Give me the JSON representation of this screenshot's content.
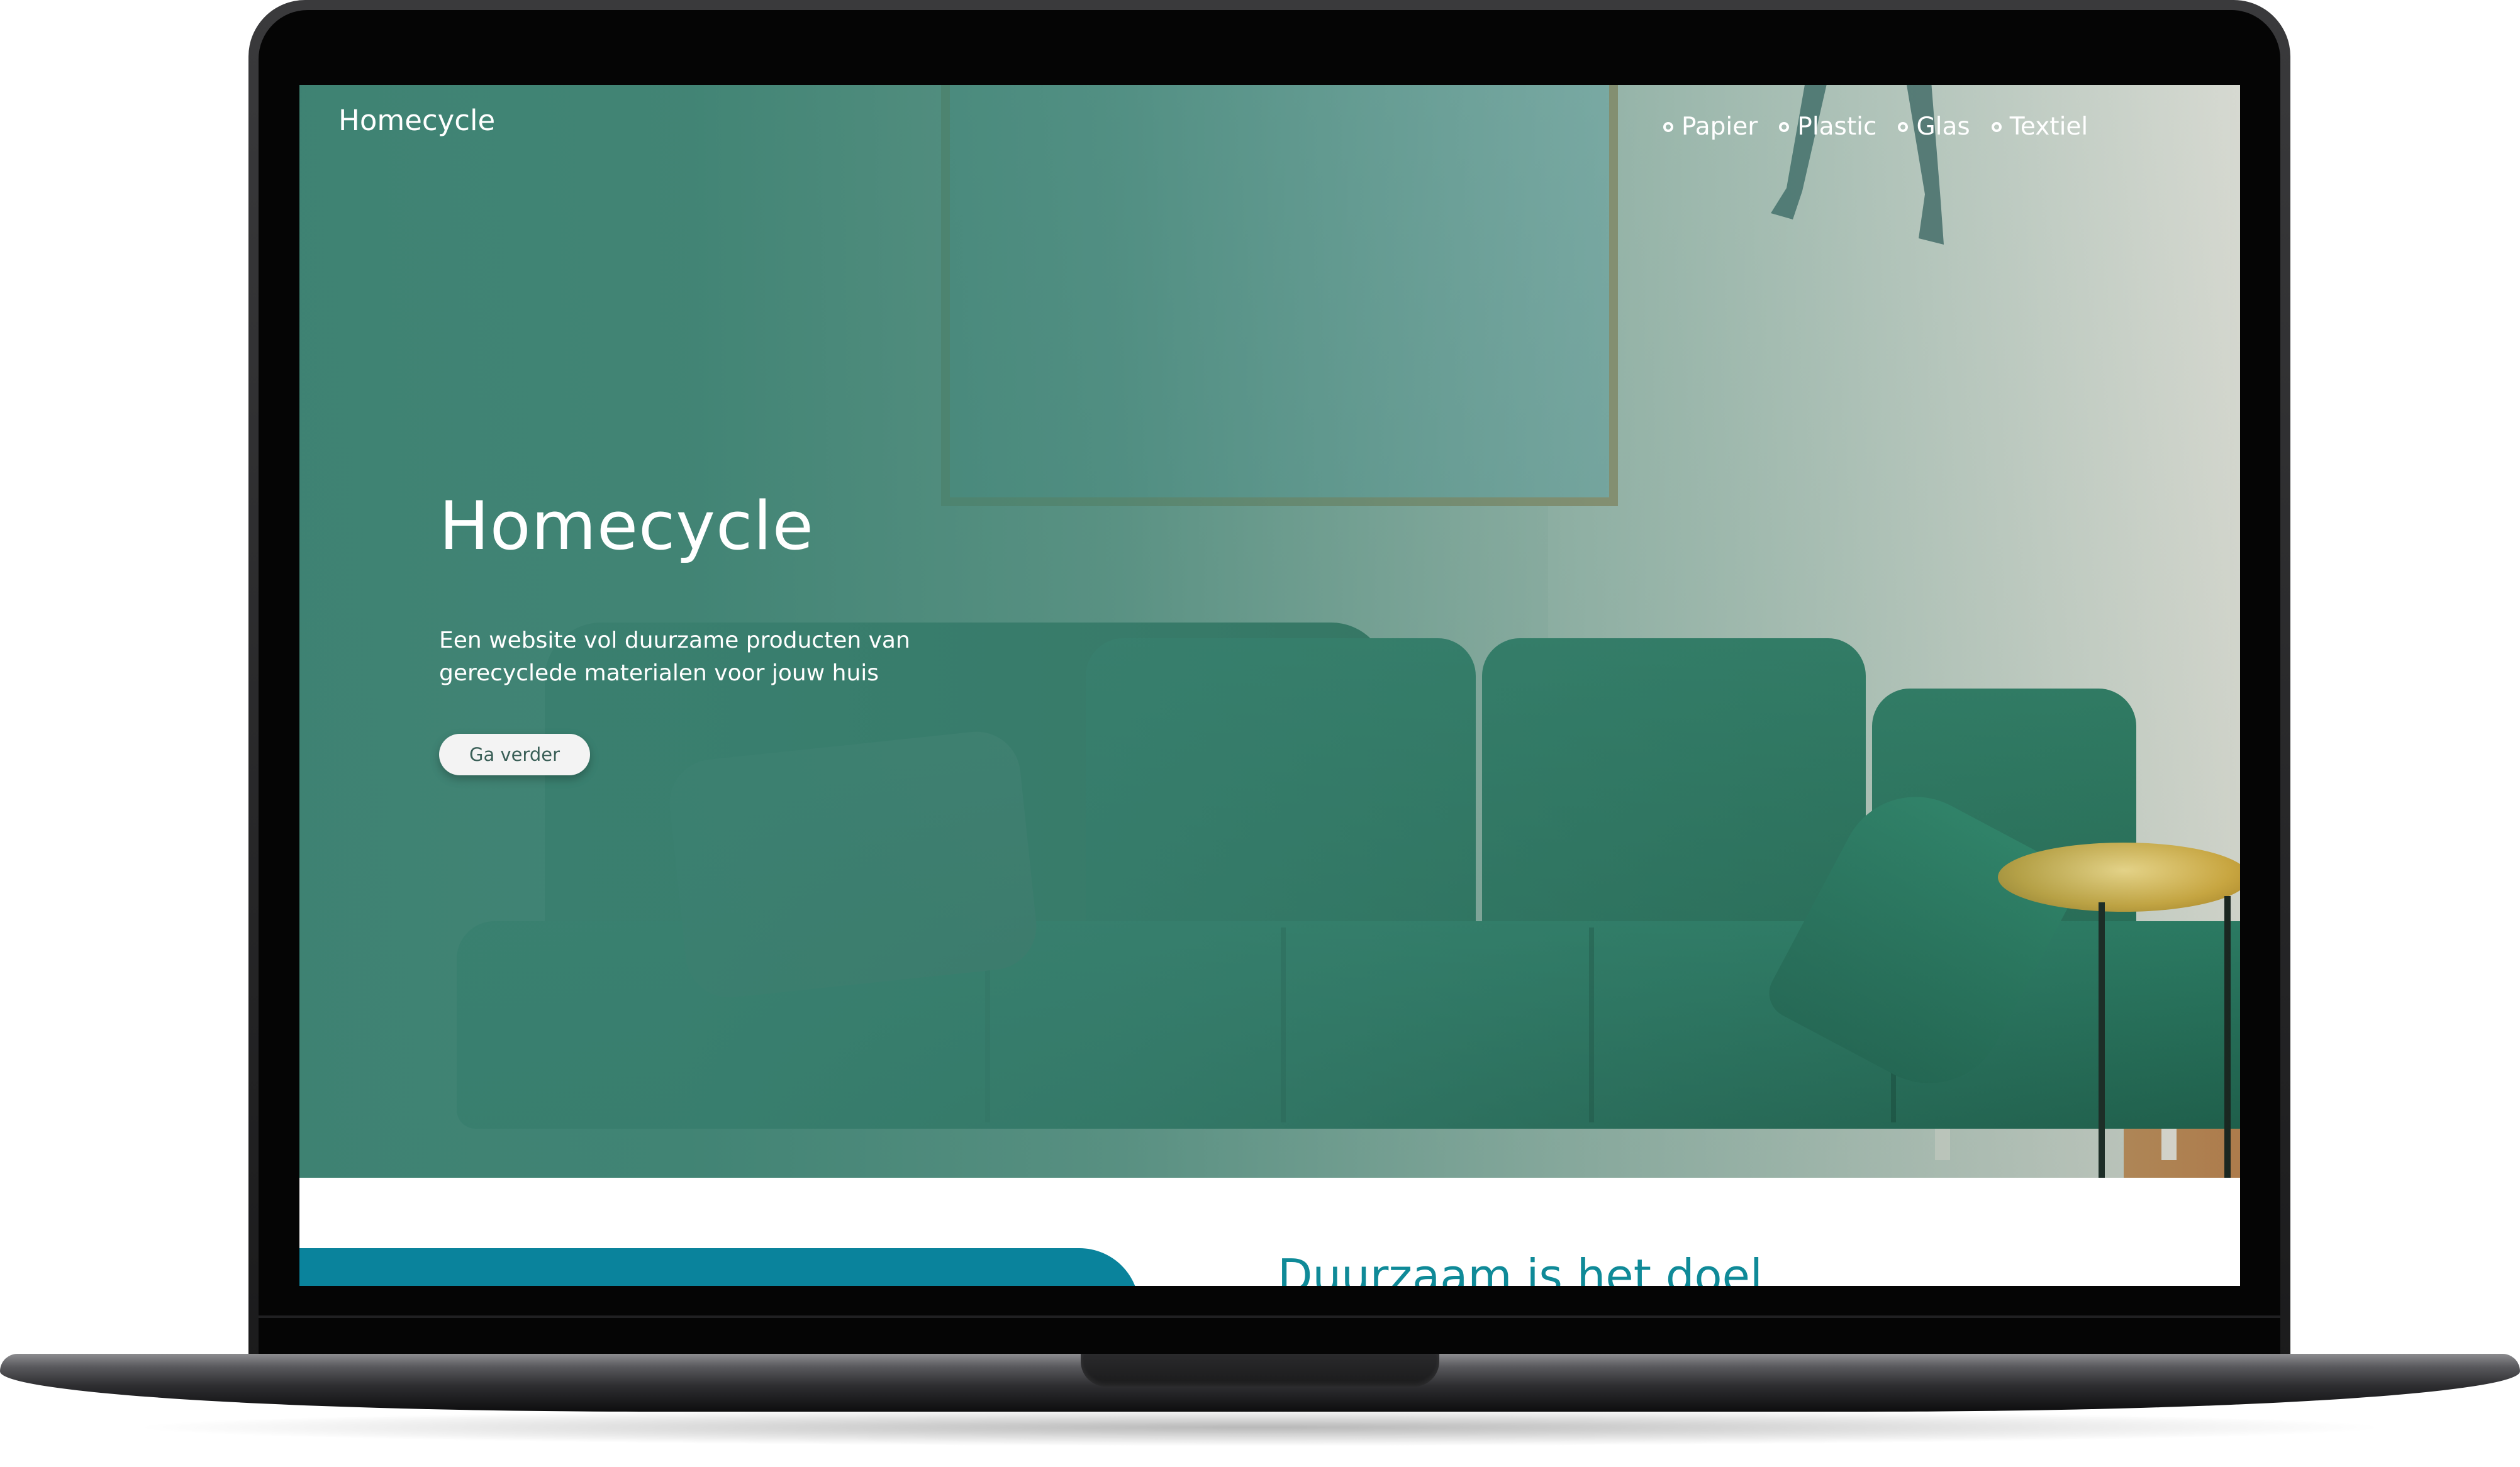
{
  "site": {
    "brand": "Homecycle",
    "nav": [
      {
        "label": "Papier"
      },
      {
        "label": "Plastic"
      },
      {
        "label": "Glas"
      },
      {
        "label": "Textiel"
      }
    ]
  },
  "hero": {
    "title": "Homecycle",
    "subtitle": "Een website vol duurzame producten van gerecyclede materialen voor jouw huis",
    "button_label": "Ga verder"
  },
  "section": {
    "title": "Duurzaam is het doel"
  },
  "colors": {
    "overlay_teal": "#3a8070",
    "button_bg": "#f3f3f3",
    "section_blue": "#0a839c",
    "section_title": "#0f8a98",
    "laptop_body": "#1b1b1c"
  },
  "icons": [
    "radio-circle-icon"
  ]
}
